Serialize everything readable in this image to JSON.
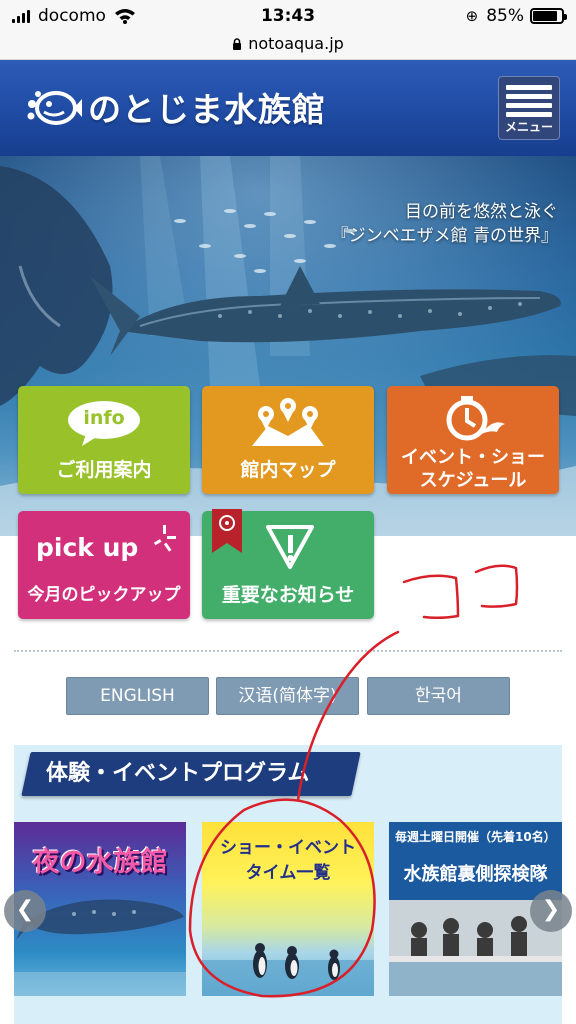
{
  "status_bar": {
    "carrier": "docomo",
    "time": "13:43",
    "battery": "85%",
    "battery_level": 0.85
  },
  "url_bar": {
    "domain": "notoaqua.jp"
  },
  "header": {
    "logo_text": "のとじま水族館",
    "menu_label": "メニュー"
  },
  "hero": {
    "caption_line1": "目の前を悠然と泳ぐ",
    "caption_line2": "『ジンベエザメ館 青の世界』"
  },
  "tiles": {
    "info": {
      "badge": "info",
      "label": "ご利用案内",
      "color": "#98c12a"
    },
    "map": {
      "label": "館内マップ",
      "color": "#e39820"
    },
    "event": {
      "label_line1": "イベント・ショー",
      "label_line2": "スケジュール",
      "color": "#e06a28"
    },
    "pickup": {
      "badge": "pick up",
      "label": "今月のピックアップ",
      "color": "#d3307c"
    },
    "news": {
      "label": "重要なお知らせ",
      "color": "#43ae6a"
    }
  },
  "languages": {
    "english": "ENGLISH",
    "chinese": "汉语(简体字)",
    "korean": "한국어"
  },
  "program": {
    "title": "体験・イベントプログラム",
    "cards": {
      "night": {
        "title": "夜の水族館"
      },
      "show": {
        "title_line1": "ショー・イベント",
        "title_line2": "タイム一覧"
      },
      "backstage": {
        "top": "毎週土曜日開催（先着10名）",
        "title": "水族館裏側探検隊"
      }
    }
  },
  "annotation": {
    "text": "ココ",
    "color": "#d9202a"
  }
}
